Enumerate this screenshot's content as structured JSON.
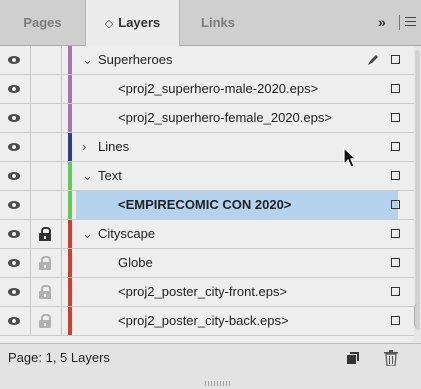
{
  "tabs": [
    {
      "label": "Pages",
      "active": false
    },
    {
      "label": "Layers",
      "active": true
    },
    {
      "label": "Links",
      "active": false
    }
  ],
  "tabbar": {
    "layers_tab_glyph": "◇",
    "overflow_label": "»",
    "menu_icon": "hamburger-menu-icon"
  },
  "layers": [
    {
      "name": "Superheroes",
      "kind": "layer",
      "expanded": true,
      "color": "#a276b0",
      "locked": false,
      "has_pen": true,
      "selected": false
    },
    {
      "name": "<proj2_superhero-male-2020.eps>",
      "kind": "item",
      "color": "#a276b0",
      "locked": false,
      "selected": false
    },
    {
      "name": "<proj2_superhero-female_2020.eps>",
      "kind": "item",
      "color": "#a276b0",
      "locked": false,
      "selected": false
    },
    {
      "name": "Lines",
      "kind": "layer",
      "expanded": false,
      "color": "#2a3e8c",
      "locked": false,
      "selected": false
    },
    {
      "name": "Text",
      "kind": "layer",
      "expanded": true,
      "color": "#5fcc55",
      "locked": false,
      "selected": false
    },
    {
      "name": "<EMPIRECOMIC CON 2020>",
      "kind": "item",
      "color": "#5fcc55",
      "locked": false,
      "selected": true
    },
    {
      "name": "Cityscape",
      "kind": "layer",
      "expanded": true,
      "color": "#d43f2c",
      "locked": true,
      "selected": false
    },
    {
      "name": "Globe",
      "kind": "item",
      "color": "#d43f2c",
      "locked": "inherited",
      "selected": false
    },
    {
      "name": "<proj2_poster_city-front.eps>",
      "kind": "item",
      "color": "#d43f2c",
      "locked": "inherited",
      "selected": false
    },
    {
      "name": "<proj2_poster_city-back.eps>",
      "kind": "item",
      "color": "#d43f2c",
      "locked": "inherited",
      "selected": false
    }
  ],
  "status": {
    "text": "Page: 1, 5 Layers"
  },
  "icons": {
    "visibility": "eye-icon",
    "lock": "lock-icon",
    "pen": "pen-icon",
    "new_layer": "new-layer-icon",
    "delete": "trash-icon"
  },
  "colors": {
    "selection": "#b5d3ef",
    "panel_bg": "#eeeeee"
  }
}
